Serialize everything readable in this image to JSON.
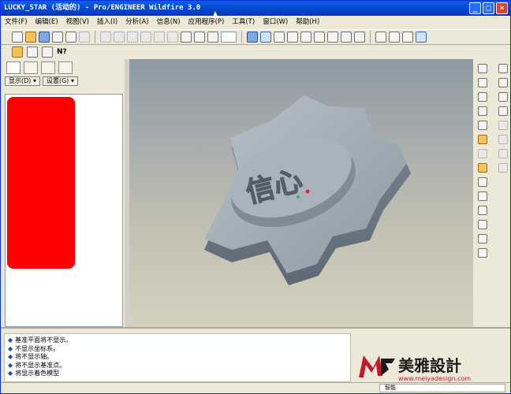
{
  "window": {
    "title": "LUCKY_STAR (活动的) - Pro/ENGINEER Wildfire 3.0",
    "minimize": "_",
    "maximize": "□",
    "close": "×"
  },
  "menu": [
    "文件(F)",
    "编辑(E)",
    "视图(V)",
    "插入(I)",
    "分析(A)",
    "信息(N)",
    "应用程序(P)",
    "工具(T)",
    "窗口(W)",
    "帮助(H)"
  ],
  "toolbar": {
    "help_label": "N?"
  },
  "panel": {
    "show_label": "显示(D) ▾",
    "settings_label": "设置(G) ▾"
  },
  "model": {
    "emboss_text": "信心"
  },
  "messages": [
    "基准平面将不显示。",
    "不显示坐标系。",
    "将不显示轴。",
    "将不显示基准点。",
    "将显示着色模型"
  ],
  "logo": {
    "brand_text": "美雅設計",
    "url": "www.meiyadesign.com"
  },
  "status": {
    "filter_text": "智能"
  },
  "colors": {
    "title_blue": "#0647d0",
    "tree_red": "#ff0000",
    "logo_red": "#c0192e"
  }
}
